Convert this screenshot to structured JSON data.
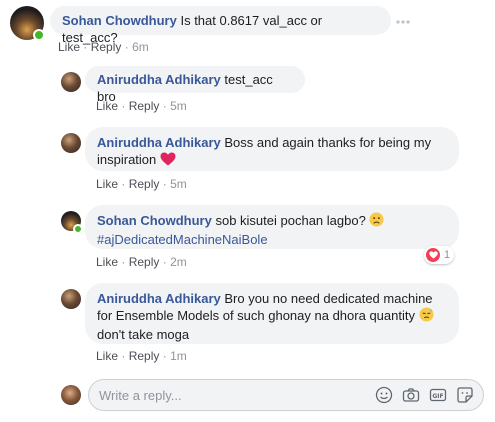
{
  "comments": [
    {
      "author": "Sohan Chowdhury",
      "text": "Is that 0.8617 val_acc or test_acc?",
      "like": "Like",
      "reply": "Reply",
      "time": "6m"
    }
  ],
  "replies": [
    {
      "author": "Aniruddha Adhikary",
      "text": "test_acc bro",
      "like": "Like",
      "reply": "Reply",
      "time": "5m"
    },
    {
      "author": "Aniruddha Adhikary",
      "text_line1": "Boss and again thanks for being my",
      "text_line2": "inspiration",
      "emoji": "red-heart",
      "like": "Like",
      "reply": "Reply",
      "time": "5m"
    },
    {
      "author": "Sohan Chowdhury",
      "text_line1": "sob kisutei pochan lagbo?",
      "hashtag": "#ajDedicatedMachineNaiBole",
      "emoji": "disappointed-face",
      "like": "Like",
      "reply": "Reply",
      "time": "2m",
      "reaction_count": "1",
      "reaction": "love"
    },
    {
      "author": "Aniruddha Adhikary",
      "text_line1": "Bro you no need dedicated machine",
      "text_line2": "for Ensemble Models of such ghonay na dhora quantity",
      "text_line3": "don't take moga",
      "emoji": "downcast-sweat-face",
      "like": "Like",
      "reply": "Reply",
      "time": "1m"
    }
  ],
  "separator": "·",
  "reply_box": {
    "placeholder": "Write a reply..."
  },
  "icons": [
    "more-icon",
    "emoji-icon",
    "camera-icon",
    "gif-icon",
    "sticker-icon",
    "heart-reaction-icon"
  ],
  "colors": {
    "link": "#385898",
    "bubble": "#f2f3f5",
    "meta": "#90949c",
    "online": "#42b72a",
    "love": "#f33e58"
  }
}
